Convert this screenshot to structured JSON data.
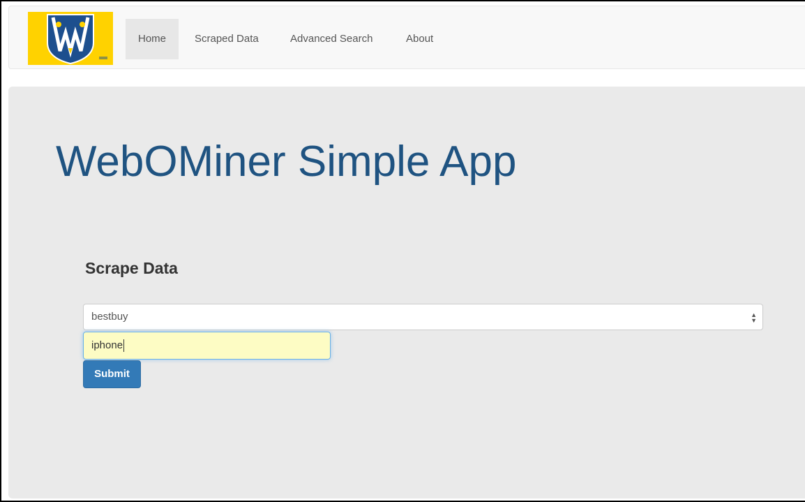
{
  "nav": {
    "logo_alt": "University of Windsor crest",
    "items": [
      {
        "label": "Home",
        "active": true
      },
      {
        "label": "Scraped Data",
        "active": false
      },
      {
        "label": "Advanced Search",
        "active": false
      },
      {
        "label": "About",
        "active": false
      }
    ]
  },
  "main": {
    "title": "WebOMiner Simple App",
    "section_title": "Scrape Data",
    "select_value": "bestbuy",
    "search_value": "iphone",
    "submit_label": "Submit"
  },
  "colors": {
    "title": "#1f5381",
    "button": "#337ab7",
    "logo_bg": "#ffd200",
    "input_bg": "#fdfcc4"
  },
  "icons": {
    "select_arrow": "select-arrows-icon",
    "logo": "crest-logo-icon"
  }
}
